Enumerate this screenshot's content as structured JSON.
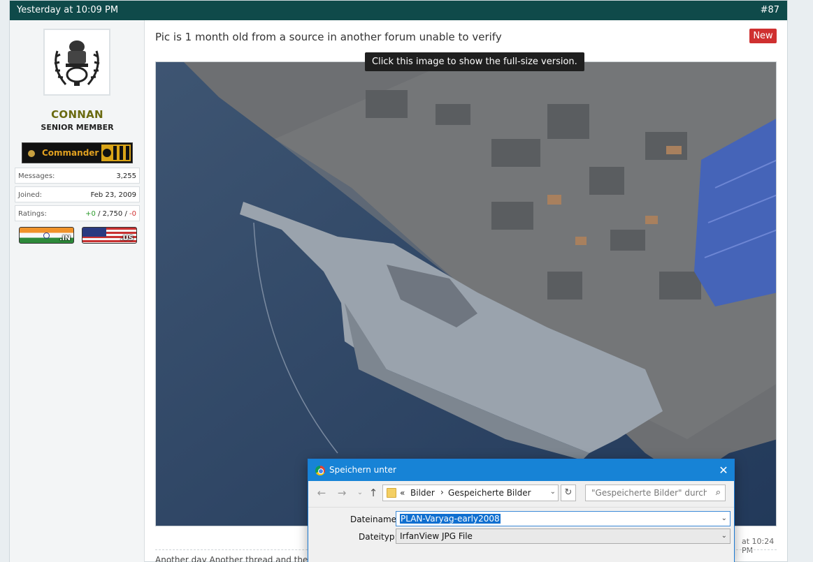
{
  "post": {
    "date": "Yesterday at 10:09 PM",
    "number": "#87",
    "title": "Pic is 1 month old from a source in another forum unable to verify",
    "new_badge": "New",
    "image_tooltip": "Click this image to show the full-size version.",
    "footer_date_fragment": "at 10:24 PM",
    "next_post_fragment": "Another day Another thread and the"
  },
  "user": {
    "name": "CONNAN",
    "title": "SENIOR MEMBER",
    "rank": "Commander",
    "stats": [
      {
        "label": "Messages:",
        "value": "3,255"
      },
      {
        "label": "Joined:",
        "value": "Feb 23, 2009"
      }
    ],
    "ratings": {
      "label": "Ratings:",
      "positive": "+0",
      "sep1": " / ",
      "neutral": "2,750",
      "sep2": " / ",
      "negative": "-0"
    },
    "flags": [
      ".IN",
      ".US"
    ]
  },
  "dialog": {
    "title": "Speichern unter",
    "breadcrumb": {
      "prefix": "«",
      "folder": "Bilder",
      "separator": "›",
      "subfolder": "Gespeicherte Bilder"
    },
    "search_placeholder": "\"Gespeicherte Bilder\" durchsuchen",
    "filename_label": "Dateiname:",
    "filename_value": "PLAN-Varyag-early2008",
    "filetype_label": "Dateityp:",
    "filetype_value": "IrfanView JPG File"
  },
  "icons": [
    "emblem-icon",
    "rank-star-icon",
    "chrome-icon",
    "close-icon",
    "back-arrow-icon",
    "forward-arrow-icon",
    "up-arrow-icon",
    "folder-icon",
    "refresh-icon",
    "search-icon",
    "chevron-down-icon"
  ],
  "colors": {
    "header": "#0f4a4a",
    "username": "#6a6a10",
    "new_badge": "#cf3030",
    "dialog_title": "#1783d6"
  }
}
